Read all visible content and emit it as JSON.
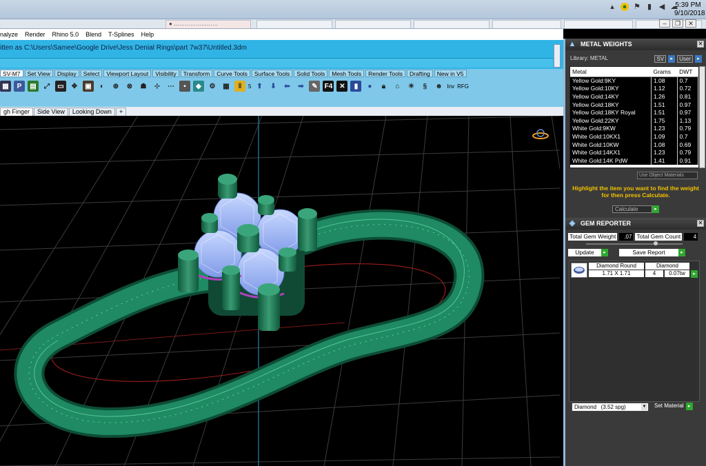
{
  "taskbar": {
    "time": "5:39 PM",
    "date": "9/10/2018"
  },
  "menubar": {
    "items": [
      "nalyze",
      "Render",
      "Rhino 5.0",
      "Blend",
      "T-Splines",
      "Help"
    ]
  },
  "command": {
    "line": "itten as C:\\Users\\Samee\\Google Drive\\Jess Denial Rings\\part 7w37\\Untitled.3dm"
  },
  "toolbar_tabs": [
    "SV-M7",
    "Set View",
    "Display",
    "Select",
    "Viewport Layout",
    "Visibility",
    "Transform",
    "Curve Tools",
    "Surface Tools",
    "Solid Tools",
    "Mesh Tools",
    "Render Tools",
    "Drafting",
    "New in V5"
  ],
  "toolbar_text": {
    "num": "5",
    "inv": "Inv",
    "rfg": "RFG"
  },
  "viewport_tabs": [
    "gh Finger",
    "Side View",
    "Looking Down",
    "+"
  ],
  "metal_weights": {
    "title": "METAL WEIGHTS",
    "library": "Library: METAL",
    "btn_sv": "SV",
    "btn_user": "User",
    "columns": [
      "Metal",
      "Grams",
      "DWT"
    ],
    "rows": [
      [
        "Yellow Gold:9KY",
        "1.08",
        "0.7"
      ],
      [
        "Yellow Gold:10KY",
        "1.12",
        "0.72"
      ],
      [
        "Yellow Gold:14KY",
        "1.26",
        "0.81"
      ],
      [
        "Yellow Gold:18KY",
        "1.51",
        "0.97"
      ],
      [
        "Yellow Gold:18KY Royal",
        "1.51",
        "0.97"
      ],
      [
        "Yellow Gold:22KY",
        "1.75",
        "1.13"
      ],
      [
        "White Gold:9KW",
        "1.23",
        "0.79"
      ],
      [
        "White Gold:10KX1",
        "1.09",
        "0.7"
      ],
      [
        "White Gold:10KW",
        "1.08",
        "0.69"
      ],
      [
        "White Gold:14KX1",
        "1.23",
        "0.79"
      ],
      [
        "White Gold:14K PdW",
        "1.41",
        "0.91"
      ]
    ],
    "use_object": "Use Object Materials",
    "help": "Highlight the item you want to find the weight for then press Calculate.",
    "calculate": "Calculate"
  },
  "gem_reporter": {
    "title": "GEM REPORTER",
    "total_weight_label": "Total Gem Weight",
    "total_weight": ".07",
    "total_count_label": "Total Gem Count",
    "total_count": "4",
    "update": "Update",
    "save_report": "Save Report",
    "item": {
      "name": "Diamond Round",
      "size": "1.71 X 1.71",
      "type": "Diamond",
      "count": "4",
      "weight": "0.07tw"
    },
    "material": "Diamond   (3.52 spg)",
    "set_material": "Set Material"
  }
}
